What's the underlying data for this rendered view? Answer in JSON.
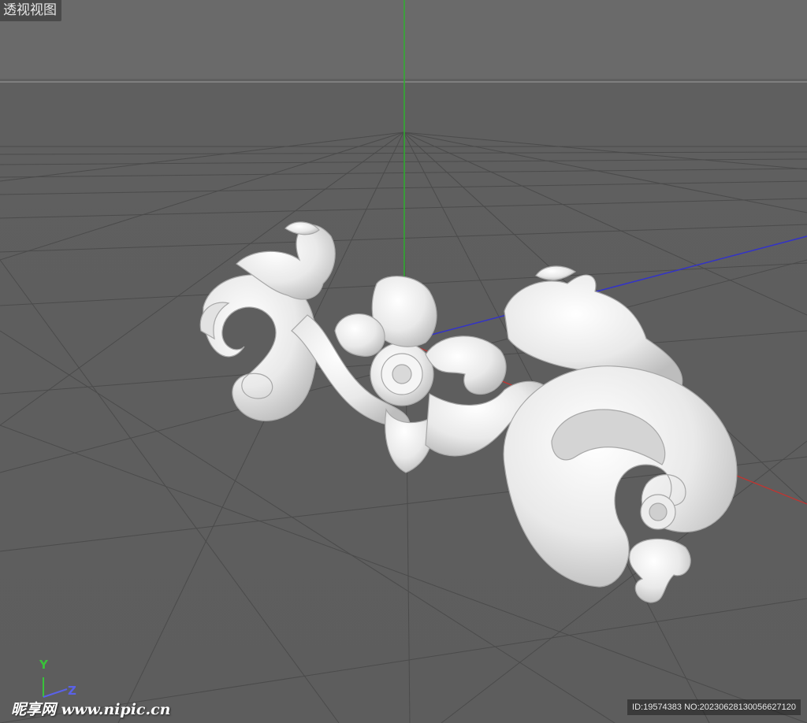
{
  "viewport": {
    "label": "透视视图",
    "background": "#5f5f5f",
    "grid_color": "#4a4a4a",
    "axis_colors": {
      "x": "#c8322e",
      "y": "#2fb02f",
      "z": "#3333c8"
    },
    "model": "ornamental-scroll-carving"
  },
  "gizmo": {
    "y_label": "Y",
    "z_label": "Z"
  },
  "watermark": {
    "text": "昵享网 www.nipic.cn"
  },
  "image_id": {
    "text": "ID:19574383 NO:20230628130056627120"
  }
}
